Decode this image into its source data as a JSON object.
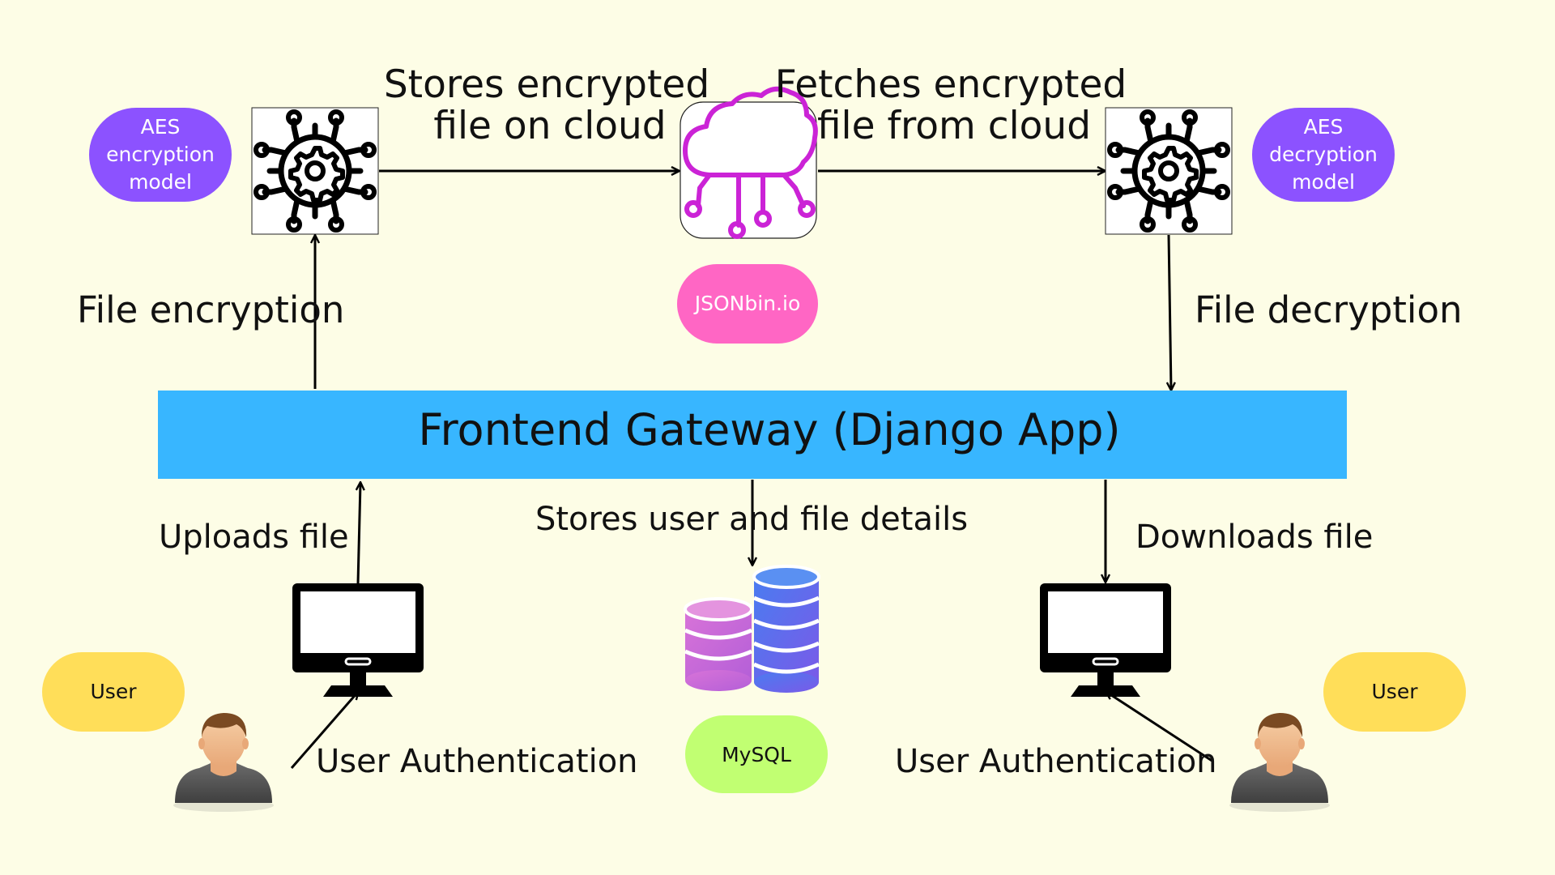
{
  "colors": {
    "background": "#fdfde6",
    "gateway": "#38b6ff",
    "aes_pill": "#8c52ff",
    "jsonbin_pill": "#ff66c4",
    "mysql_pill": "#c1ff72",
    "user_pill": "#ffde59",
    "cloud_icon": "#cb23d6",
    "arrow": "#000000"
  },
  "gateway": {
    "label": "Frontend Gateway (Django App)"
  },
  "encryption_node": {
    "pill_lines": [
      "AES",
      "encryption",
      "model"
    ],
    "icon": "gear-network-icon"
  },
  "decryption_node": {
    "pill_lines": [
      "AES",
      "decryption",
      "model"
    ],
    "icon": "gear-network-icon"
  },
  "cloud": {
    "icon": "cloud-circuit-icon",
    "pill": "JSONbin.io"
  },
  "database": {
    "icon": "database-stack-icon",
    "pill": "MySQL"
  },
  "edge_labels": {
    "stores_encrypted": [
      "Stores encrypted",
      "file on cloud"
    ],
    "fetches_encrypted": [
      "Fetches encrypted",
      "file from cloud"
    ],
    "file_encryption": "File encryption",
    "file_decryption": "File decryption",
    "uploads_file": "Uploads file",
    "downloads_file": "Downloads file",
    "stores_user_details": "Stores user and file details",
    "user_auth_left": "User Authentication",
    "user_auth_right": "User Authentication"
  },
  "users": {
    "left_pill": "User",
    "right_pill": "User",
    "icon": "user-avatar-icon",
    "computer_icon": "monitor-icon"
  }
}
